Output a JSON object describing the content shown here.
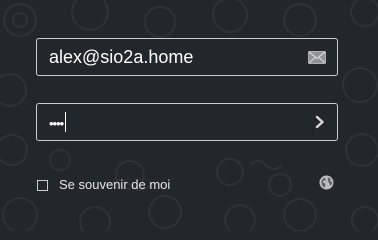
{
  "login": {
    "email_value": "alex@sio2a.home",
    "password_value": "••••",
    "remember_label": "Se souvenir de moi",
    "remember_checked": false
  },
  "icons": {
    "email": "envelope-icon",
    "submit": "chevron-right-icon",
    "language": "globe-icon"
  },
  "colors": {
    "background": "#22272b",
    "border": "#c9ccd0",
    "text": "#ffffff"
  }
}
